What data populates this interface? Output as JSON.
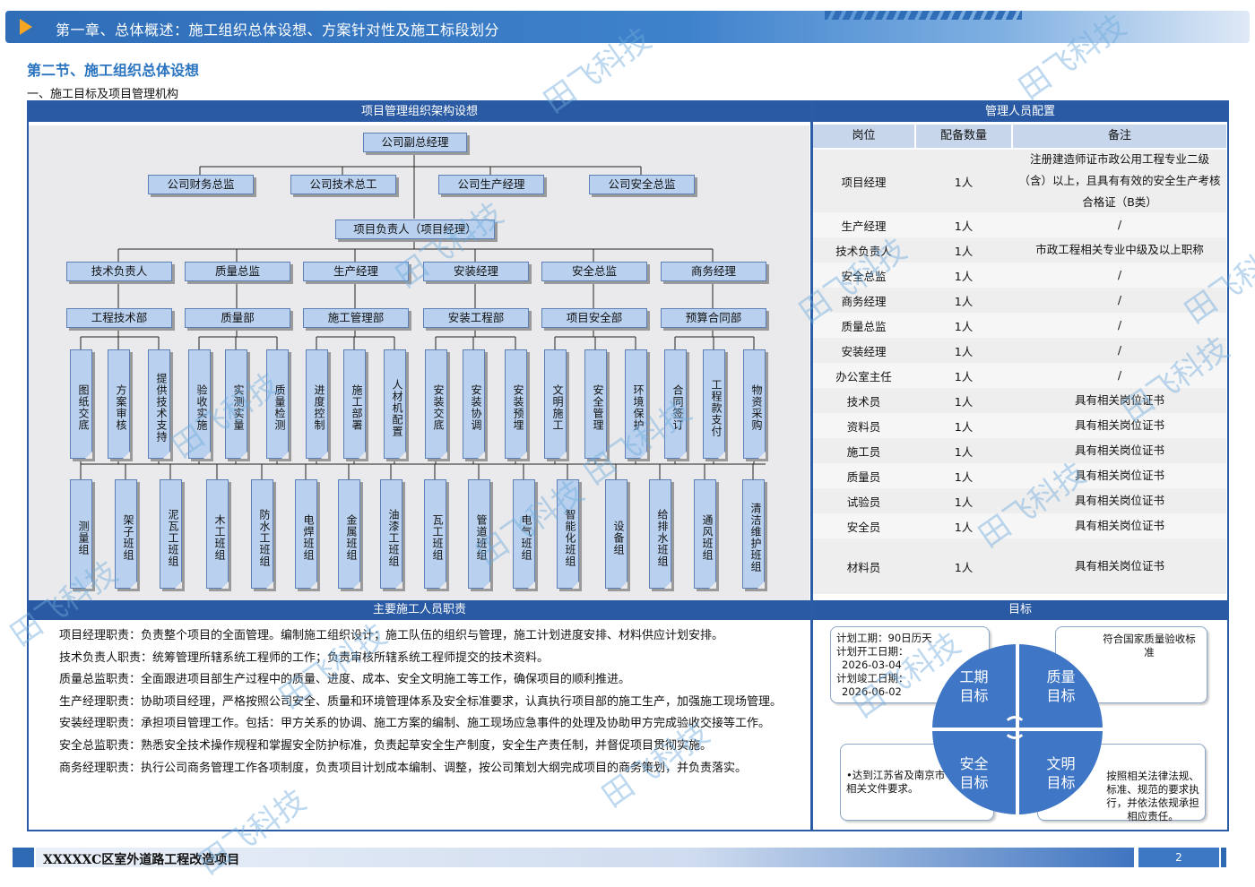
{
  "header": {
    "chapter_title": "第一章、总体概述：施工组织总体设想、方案针对性及施工标段划分"
  },
  "section_title": "第二节、施工组织总体设想",
  "subsection_title": "一、施工目标及项目管理机构",
  "org": {
    "title": "项目管理组织架构设想",
    "top": "公司副总经理",
    "company": [
      "公司财务总监",
      "公司技术总工",
      "公司生产经理",
      "公司安全总监"
    ],
    "project_head": "项目负责人（项目经理）",
    "managers": [
      "技术负责人",
      "质量总监",
      "生产经理",
      "安装经理",
      "安全总监",
      "商务经理"
    ],
    "departments": [
      "工程技术部",
      "质量部",
      "施工管理部",
      "安装工程部",
      "项目安全部",
      "预算合同部"
    ],
    "tasks": [
      "图纸交底",
      "方案审核",
      "提供技术支持",
      "验收实施",
      "实测实量",
      "质量检测",
      "进度控制",
      "施工部署",
      "人材机配置",
      "安装交底",
      "安装协调",
      "安装预埋",
      "文明施工",
      "安全管理",
      "环境保护",
      "合同签订",
      "工程款支付",
      "物资采购"
    ],
    "teams": [
      "测量组",
      "架子班组",
      "泥瓦工班组",
      "木工班组",
      "防水工班组",
      "电焊班组",
      "金属班组",
      "油漆工班组",
      "瓦工班组",
      "管道班组",
      "电气班组",
      "智能化班组",
      "设备组",
      "给排水班组",
      "通风班组",
      "清洁维护班组"
    ]
  },
  "staff": {
    "title": "管理人员配置",
    "headers": [
      "岗位",
      "配备数量",
      "备注"
    ],
    "rows": [
      [
        "项目经理",
        "1人",
        "注册建造师证市政公用工程专业二级（含）以上，且具有有效的安全生产考核合格证（B类）"
      ],
      [
        "生产经理",
        "1人",
        "/"
      ],
      [
        "技术负责人",
        "1人",
        "市政工程相关专业中级及以上职称"
      ],
      [
        "安全总监",
        "1人",
        "/"
      ],
      [
        "商务经理",
        "1人",
        "/"
      ],
      [
        "质量总监",
        "1人",
        "/"
      ],
      [
        "安装经理",
        "1人",
        "/"
      ],
      [
        "办公室主任",
        "1人",
        "/"
      ],
      [
        "技术员",
        "1人",
        "具有相关岗位证书"
      ],
      [
        "资料员",
        "1人",
        "具有相关岗位证书"
      ],
      [
        "施工员",
        "1人",
        "具有相关岗位证书"
      ],
      [
        "质量员",
        "1人",
        "具有相关岗位证书"
      ],
      [
        "试验员",
        "1人",
        "具有相关岗位证书"
      ],
      [
        "安全员",
        "1人",
        "具有相关岗位证书"
      ],
      [
        "材料员",
        "1人",
        "具有相关岗位证书"
      ]
    ]
  },
  "duties": {
    "title": "主要施工人员职责",
    "items": [
      "项目经理职责：负责整个项目的全面管理。编制施工组织设计；施工队伍的组织与管理，施工计划进度安排、材料供应计划安排。",
      "技术负责人职责：统筹管理所辖系统工程师的工作；负责审核所辖系统工程师提交的技术资料。",
      "质量总监职责：全面跟进项目部生产过程中的质量、进度、成本、安全文明施工等工作，确保项目的顺利推进。",
      "生产经理职责：协助项目经理，严格按照公司安全、质量和环境管理体系及安全标准要求，认真执行项目部的施工生产，加强施工现场管理。",
      "安装经理职责：承担项目管理工作。包括：甲方关系的协调、施工方案的编制、施工现场应急事件的处理及协助甲方完成验收交接等工作。",
      "安全总监职责：熟悉安全技术操作规程和掌握安全防护标准，负责起草安全生产制度，安全生产责任制，并督促项目贯彻实施。",
      "商务经理职责：执行公司商务管理工作各项制度，负责项目计划成本编制、调整，按公司策划大纲完成项目的商务策划，并负责落实。"
    ]
  },
  "goals": {
    "title": "目标",
    "schedule": {
      "line1": "计划工期：90日历天",
      "line2": "计划开工日期：",
      "start": "2026-03-04",
      "line3": "计划竣工日期：",
      "end": "2026-06-02"
    },
    "quality_text": "符合国家质量验收标准",
    "safety_text": "•达到江苏省及南京市相关文件要求。",
    "civil_text": "按照相关法律法规、标准、规范的要求执行，并依法依规承担相应责任。",
    "q1": "工期\n目标",
    "q2": "质量\n目标",
    "q3": "安全\n目标",
    "q4": "文明\n目标"
  },
  "footer": {
    "project_name": "XXXXXC区室外道路工程改造项目",
    "page": "2"
  },
  "watermark": "田飞科技",
  "colors": {
    "primary": "#2a5aa3",
    "node_fill": "#b9d1ee",
    "accent": "#f5a623",
    "section": "#2a74c0"
  }
}
